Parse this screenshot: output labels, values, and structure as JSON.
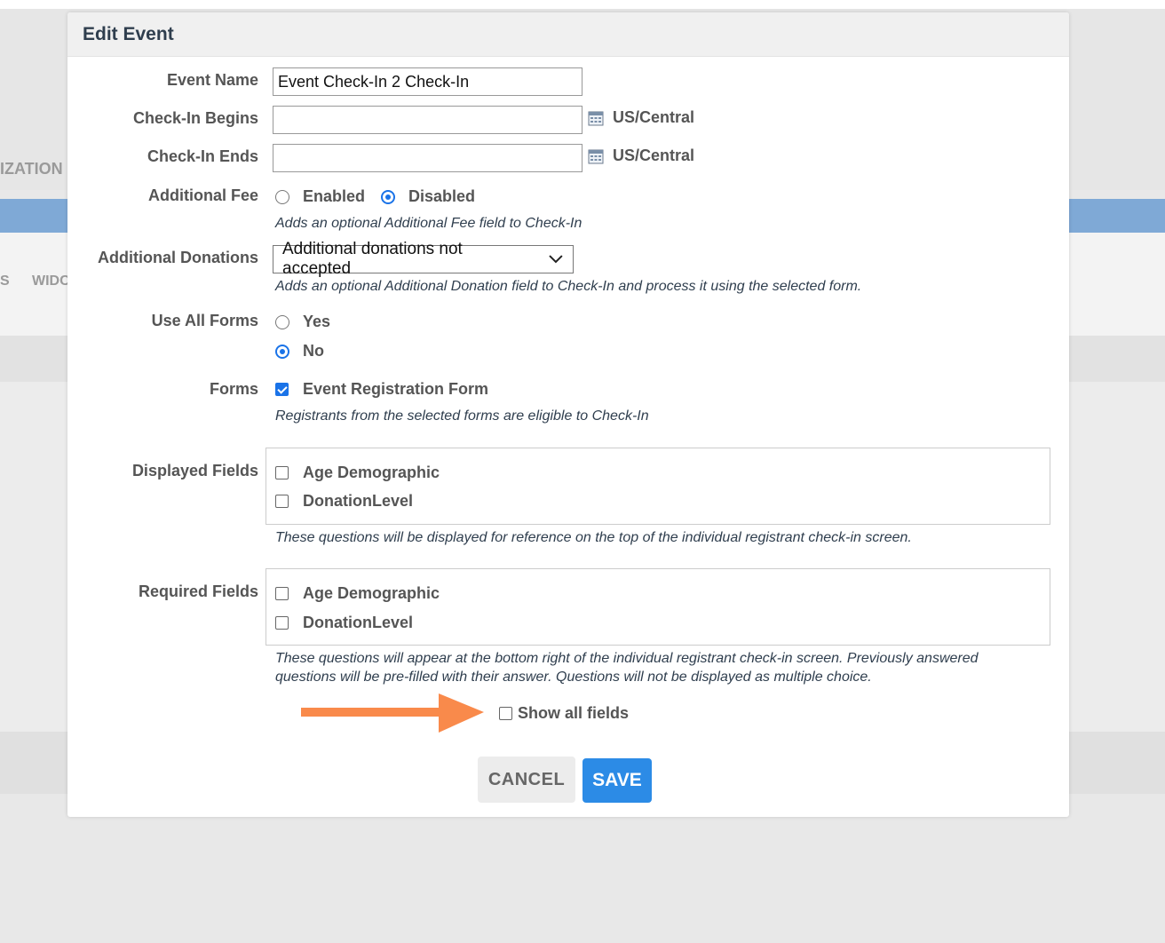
{
  "background": {
    "left_label_1": "IZATION",
    "left_label_2": "S",
    "left_label_3": "WIDC"
  },
  "modal": {
    "title": "Edit Event",
    "event_name": {
      "label": "Event Name",
      "value": "Event Check-In 2 Check-In"
    },
    "checkin_begins": {
      "label": "Check-In Begins",
      "value": "",
      "timezone": "US/Central"
    },
    "checkin_ends": {
      "label": "Check-In Ends",
      "value": "",
      "timezone": "US/Central"
    },
    "additional_fee": {
      "label": "Additional Fee",
      "options": [
        "Enabled",
        "Disabled"
      ],
      "selected": "Disabled",
      "help": "Adds an optional Additional Fee field to Check-In"
    },
    "additional_donations": {
      "label": "Additional Donations",
      "selected": "Additional donations not accepted",
      "help": "Adds an optional Additional Donation field to Check-In and process it using the selected form."
    },
    "use_all_forms": {
      "label": "Use All Forms",
      "options": [
        "Yes",
        "No"
      ],
      "selected": "No"
    },
    "forms": {
      "label": "Forms",
      "items": [
        {
          "label": "Event Registration Form",
          "checked": true
        }
      ],
      "help": "Registrants from the selected forms are eligible to Check-In"
    },
    "displayed_fields": {
      "label": "Displayed Fields",
      "items": [
        {
          "label": "Age Demographic",
          "checked": false
        },
        {
          "label": "DonationLevel",
          "checked": false
        }
      ],
      "help": "These questions will be displayed for reference on the top of the individual registrant check-in screen."
    },
    "required_fields": {
      "label": "Required Fields",
      "items": [
        {
          "label": "Age Demographic",
          "checked": false
        },
        {
          "label": "DonationLevel",
          "checked": false
        }
      ],
      "help_line1": "These questions will appear at the bottom right of the individual registrant check-in screen. Previously answered",
      "help_line2": "questions will be pre-filled with their answer. Questions will not be displayed as multiple choice."
    },
    "show_all_fields": {
      "label": "Show all fields",
      "checked": false
    },
    "buttons": {
      "cancel": "CANCEL",
      "save": "SAVE"
    }
  },
  "colors": {
    "accent": "#1a73e8",
    "save_button": "#2c8be6",
    "annotation_arrow": "#f98a4b",
    "background_bar": "#7fa9d6"
  }
}
